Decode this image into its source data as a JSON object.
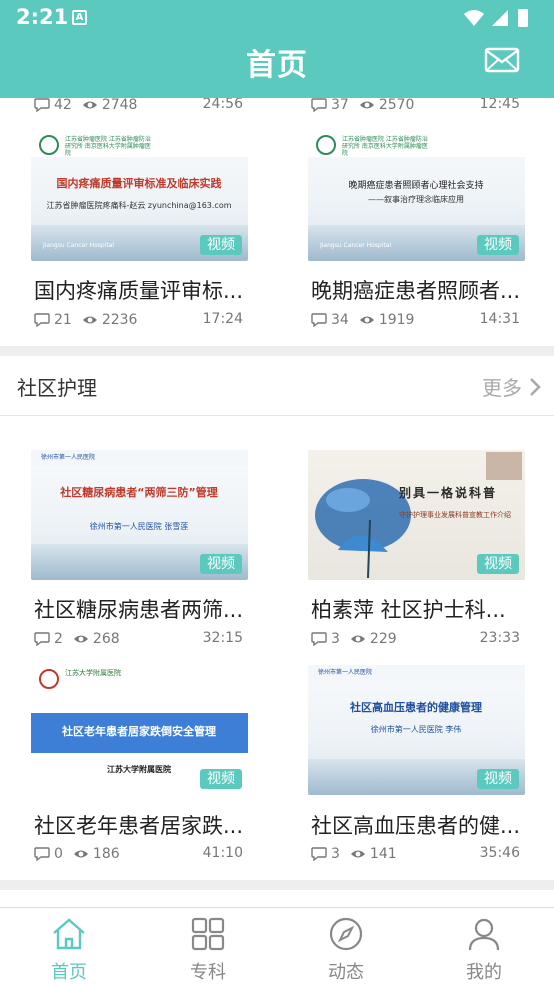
{
  "status_bar": {
    "time": "2:21",
    "notif_icon": "A"
  },
  "header": {
    "title": "首页",
    "mail_icon": "mail-icon"
  },
  "colors": {
    "accent": "#5cc9bf",
    "text": "#222222",
    "muted": "#777777"
  },
  "top_partial_row": [
    {
      "comments": "42",
      "views": "2748",
      "duration": "24:56"
    },
    {
      "comments": "37",
      "views": "2570",
      "duration": "12:45"
    }
  ],
  "row1": [
    {
      "thumb_hospital": "江苏省肿瘤医院 江苏省肿瘤防治研究所 南京医科大学附属肿瘤医院",
      "thumb_title": "国内疼痛质量评审标准及临床实践",
      "thumb_sub": "江苏省肿瘤医院疼痛科-赵云 zyunchina@163.com",
      "thumb_footer": "Jiangsu Cancer Hospital",
      "badge": "视频",
      "title": "国内疼痛质量评审标...",
      "comments": "21",
      "views": "2236",
      "duration": "17:24"
    },
    {
      "thumb_hospital": "江苏省肿瘤医院 江苏省肿瘤防治研究所 南京医科大学附属肿瘤医院",
      "thumb_title": "晚期癌症患者照顾者心理社会支持",
      "thumb_sub": "——叙事治疗理念临床应用",
      "thumb_footer": "Jiangsu Cancer Hospital",
      "badge": "视频",
      "title": "晚期癌症患者照顾者...",
      "comments": "34",
      "views": "1919",
      "duration": "14:31"
    }
  ],
  "section": {
    "title": "社区护理",
    "more": "更多"
  },
  "row2": [
    {
      "thumb_hospital": "徐州市第一人民医院",
      "thumb_title": "社区糖尿病患者“两筛三防”管理",
      "thumb_sub": "徐州市第一人民医院 张雪莲",
      "badge": "视频",
      "title": "社区糖尿病患者两筛...",
      "comments": "2",
      "views": "268",
      "duration": "32:15"
    },
    {
      "thumb_title": "别具一格说科普",
      "thumb_sub": "守护护理事业发展科普宣教工作介绍",
      "badge": "视频",
      "title": "柏素萍 社区护士科...",
      "comments": "3",
      "views": "229",
      "duration": "23:33"
    }
  ],
  "row3": [
    {
      "thumb_hospital": "江苏大学附属医院",
      "thumb_title": "社区老年患者居家跌倒安全管理",
      "thumb_sub": "江苏大学附属医院",
      "badge": "视频",
      "title": "社区老年患者居家跌...",
      "comments": "0",
      "views": "186",
      "duration": "41:10"
    },
    {
      "thumb_hospital": "徐州市第一人民医院",
      "thumb_title": "社区高血压患者的健康管理",
      "thumb_sub": "徐州市第一人民医院 李伟",
      "badge": "视频",
      "title": "社区高血压患者的健...",
      "comments": "3",
      "views": "141",
      "duration": "35:46"
    }
  ],
  "bottom_nav": [
    {
      "label": "首页",
      "icon": "home-icon",
      "active": true
    },
    {
      "label": "专科",
      "icon": "grid-icon",
      "active": false
    },
    {
      "label": "动态",
      "icon": "compass-icon",
      "active": false
    },
    {
      "label": "我的",
      "icon": "person-icon",
      "active": false
    }
  ]
}
